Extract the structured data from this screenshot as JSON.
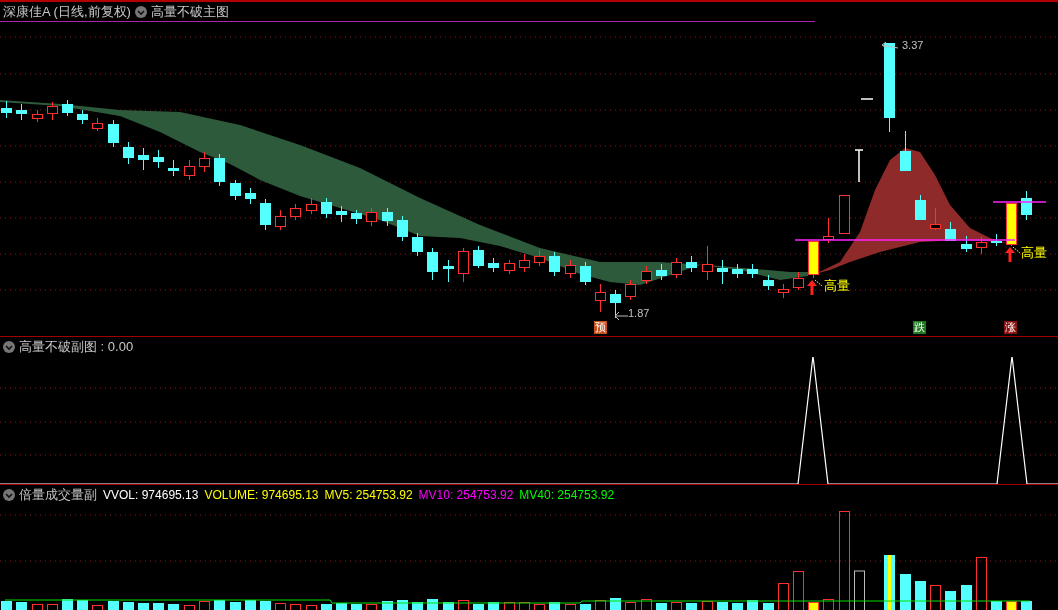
{
  "header": {
    "stock": "深康佳A (日线,前复权)",
    "indicator": "高量不破主图"
  },
  "main_chart": {
    "high_label": "3.37",
    "low_label": "1.87",
    "signals": [
      {
        "kind": "volume",
        "text": "高量"
      },
      {
        "kind": "volume",
        "text": "高量"
      }
    ],
    "badges": [
      {
        "text": "预",
        "color": "#c8501e"
      },
      {
        "text": "跌",
        "color": "#1e7a1e"
      },
      {
        "text": "涨",
        "color": "#8a1010"
      }
    ]
  },
  "sub_chart": {
    "title": "高量不破副图 : 0.00"
  },
  "volume_chart": {
    "title": "倍量成交量副",
    "readings": [
      {
        "text": "VVOL: 974695.13",
        "color": "#ffffff"
      },
      {
        "text": "VOLUME: 974695.13",
        "color": "#ffff00"
      },
      {
        "text": "MV5: 254753.92",
        "color": "#ffff00"
      },
      {
        "text": "MV10: 254753.92",
        "color": "#ff00ff"
      },
      {
        "text": "MV40: 254753.92",
        "color": "#00ff00"
      }
    ]
  }
}
